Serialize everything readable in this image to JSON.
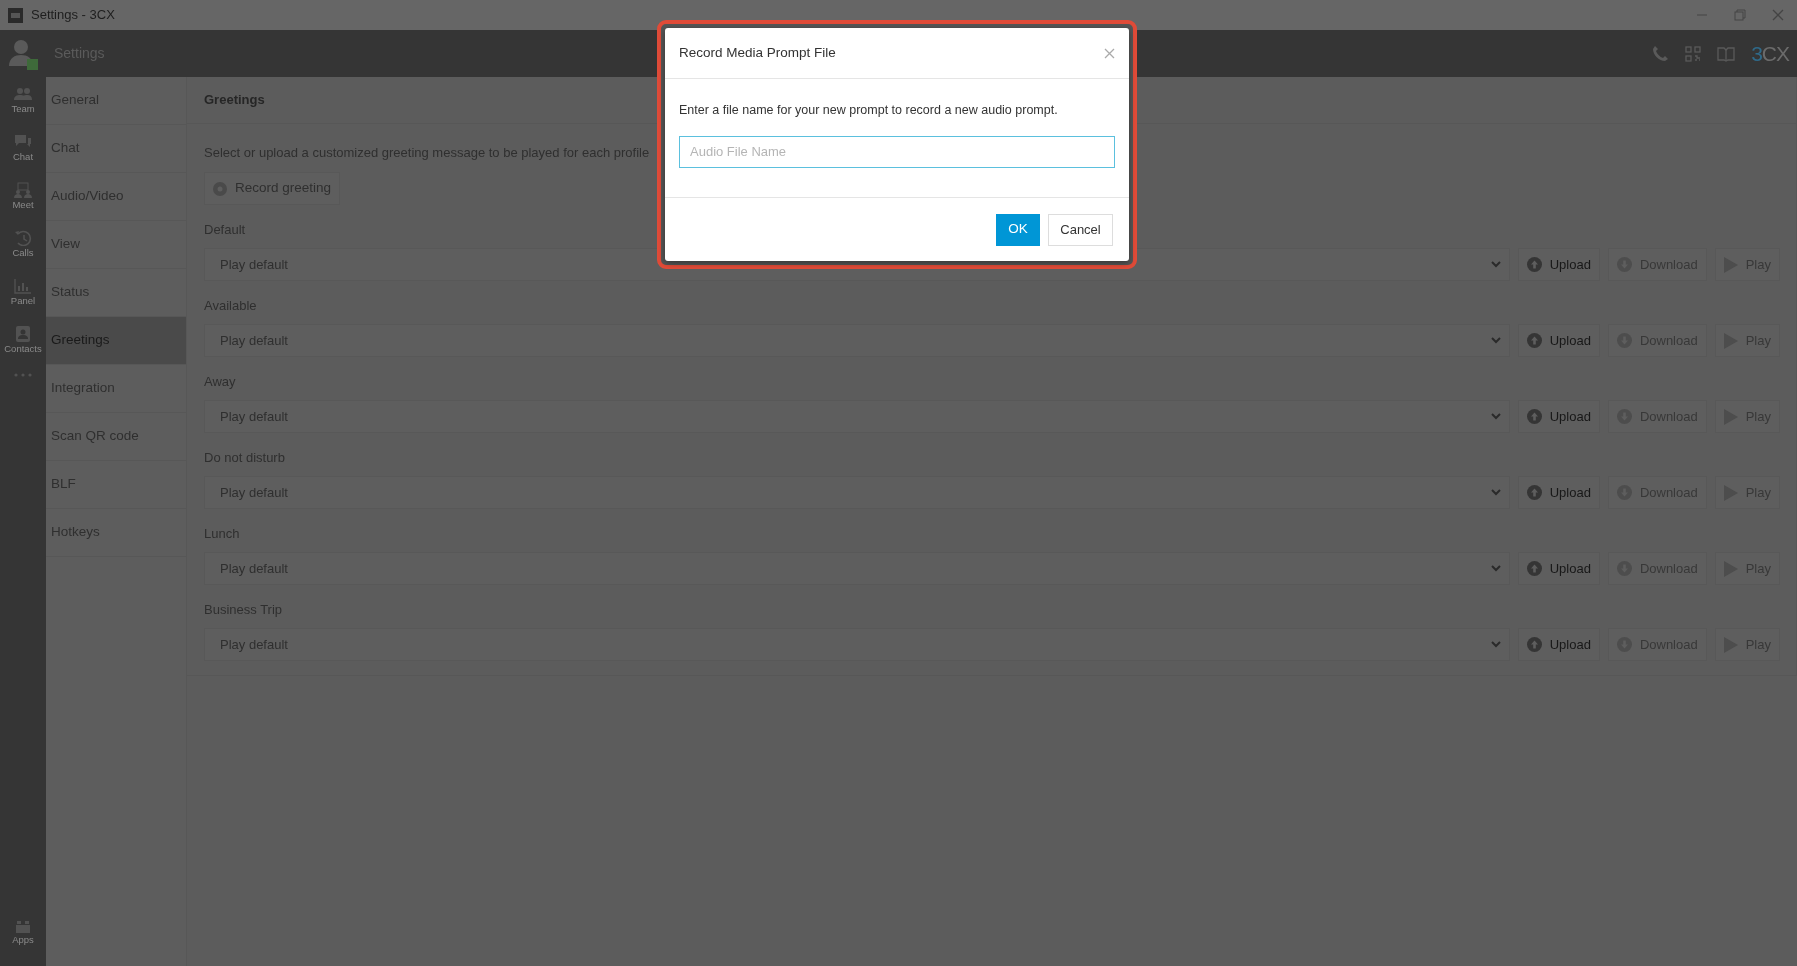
{
  "window": {
    "title": "Settings - 3CX"
  },
  "header": {
    "title": "Settings",
    "logo": "3CX"
  },
  "rail": [
    {
      "label": "Team"
    },
    {
      "label": "Chat"
    },
    {
      "label": "Meet"
    },
    {
      "label": "Calls"
    },
    {
      "label": "Panel"
    },
    {
      "label": "Contacts"
    }
  ],
  "rail_bottom": {
    "label": "Apps"
  },
  "nav": [
    {
      "label": "General",
      "selected": false
    },
    {
      "label": "Chat",
      "selected": false
    },
    {
      "label": "Audio/Video",
      "selected": false
    },
    {
      "label": "View",
      "selected": false
    },
    {
      "label": "Status",
      "selected": false
    },
    {
      "label": "Greetings",
      "selected": true
    },
    {
      "label": "Integration",
      "selected": false
    },
    {
      "label": "Scan QR code",
      "selected": false
    },
    {
      "label": "BLF",
      "selected": false
    },
    {
      "label": "Hotkeys",
      "selected": false
    }
  ],
  "section": {
    "title": "Greetings",
    "description": "Select or upload a customized greeting message to be played for each profile",
    "record_button": "Record greeting"
  },
  "profiles": [
    {
      "label": "Default",
      "value": "Play default",
      "buttons": [
        {
          "label": "Upload",
          "kind": "upload",
          "disabled": false
        },
        {
          "label": "Download",
          "kind": "download",
          "disabled": true
        },
        {
          "label": "Play",
          "kind": "play",
          "disabled": true
        }
      ]
    },
    {
      "label": "Available",
      "value": "Play default",
      "buttons": [
        {
          "label": "Upload",
          "kind": "upload",
          "disabled": false
        },
        {
          "label": "Download",
          "kind": "download",
          "disabled": true
        },
        {
          "label": "Play",
          "kind": "play",
          "disabled": true
        }
      ]
    },
    {
      "label": "Away",
      "value": "Play default",
      "buttons": [
        {
          "label": "Upload",
          "kind": "upload",
          "disabled": false
        },
        {
          "label": "Download",
          "kind": "download",
          "disabled": true
        },
        {
          "label": "Play",
          "kind": "play",
          "disabled": true
        }
      ]
    },
    {
      "label": "Do not disturb",
      "value": "Play default",
      "buttons": [
        {
          "label": "Upload",
          "kind": "upload",
          "disabled": false
        },
        {
          "label": "Download",
          "kind": "download",
          "disabled": true
        },
        {
          "label": "Play",
          "kind": "play",
          "disabled": true
        }
      ]
    },
    {
      "label": "Lunch",
      "value": "Play default",
      "buttons": [
        {
          "label": "Upload",
          "kind": "upload",
          "disabled": false
        },
        {
          "label": "Download",
          "kind": "download",
          "disabled": true
        },
        {
          "label": "Play",
          "kind": "play",
          "disabled": true
        }
      ]
    },
    {
      "label": "Business Trip",
      "value": "Play default",
      "buttons": [
        {
          "label": "Upload",
          "kind": "upload",
          "disabled": false
        },
        {
          "label": "Download",
          "kind": "download",
          "disabled": true
        },
        {
          "label": "Play",
          "kind": "play",
          "disabled": true
        }
      ]
    }
  ],
  "dialog": {
    "title": "Record Media Prompt File",
    "message": "Enter a file name for your new prompt to record a new audio prompt.",
    "placeholder": "Audio File Name",
    "ok": "OK",
    "cancel": "Cancel"
  }
}
